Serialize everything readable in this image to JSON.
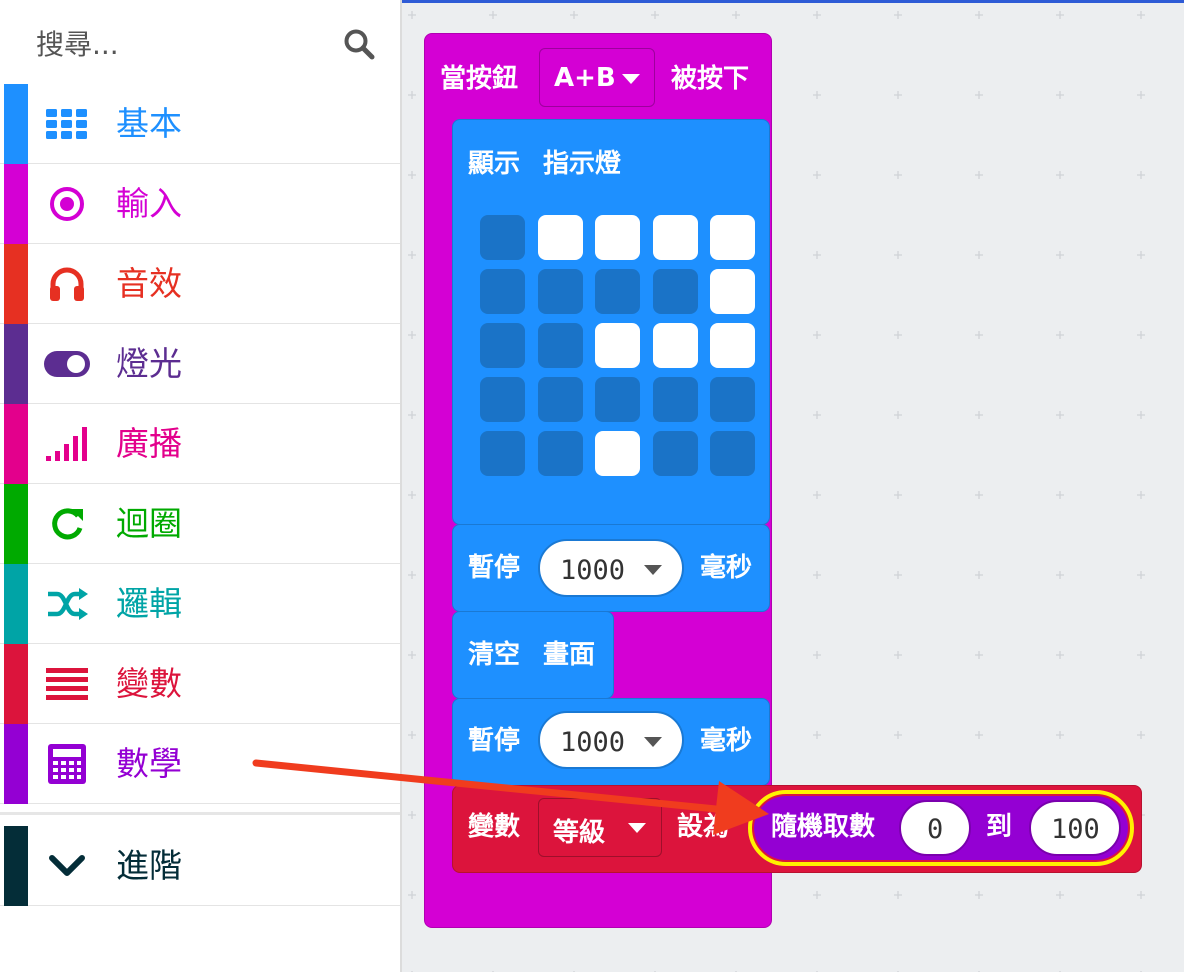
{
  "search": {
    "placeholder": "搜尋..."
  },
  "categories": [
    {
      "label": "基本",
      "color": "#1e90ff",
      "icon": "grid-icon"
    },
    {
      "label": "輸入",
      "color": "#d400d4",
      "icon": "target-icon"
    },
    {
      "label": "音效",
      "color": "#e63022",
      "icon": "headphones-icon"
    },
    {
      "label": "燈光",
      "color": "#5c2d91",
      "icon": "toggle-icon"
    },
    {
      "label": "廣播",
      "color": "#e3008c",
      "icon": "signal-bars-icon"
    },
    {
      "label": "迴圈",
      "color": "#00aa00",
      "icon": "refresh-icon"
    },
    {
      "label": "邏輯",
      "color": "#00a4a6",
      "icon": "shuffle-icon"
    },
    {
      "label": "變數",
      "color": "#dc143c",
      "icon": "lines-icon"
    },
    {
      "label": "數學",
      "color": "#9400d3",
      "icon": "calculator-icon"
    }
  ],
  "advanced": {
    "label": "進階",
    "color": "#042d38",
    "icon": "chevron-down-icon"
  },
  "blocks": {
    "event": {
      "prefix": "當按鈕",
      "button": "A+B",
      "suffix": "被按下"
    },
    "show_leds": {
      "label_1": "顯示",
      "label_2": "指示燈",
      "leds": [
        [
          0,
          1,
          1,
          1,
          1
        ],
        [
          0,
          0,
          0,
          0,
          1
        ],
        [
          0,
          0,
          1,
          1,
          1
        ],
        [
          0,
          0,
          0,
          0,
          0
        ],
        [
          0,
          0,
          1,
          0,
          0
        ]
      ]
    },
    "pause_1": {
      "label": "暫停",
      "value": "1000",
      "unit": "毫秒"
    },
    "clear": {
      "label_1": "清空",
      "label_2": "畫面"
    },
    "pause_2": {
      "label": "暫停",
      "value": "1000",
      "unit": "毫秒"
    },
    "set_var": {
      "label": "變數",
      "variable": "等級",
      "set_to": "設為"
    },
    "random": {
      "label": "隨機取數",
      "from": "0",
      "to_label": "到",
      "to": "100"
    }
  },
  "colors": {
    "event": "#d400d4",
    "event_dark": "#b100b1",
    "basic": "#1e90ff",
    "basic_dark": "#1a79d4",
    "variables": "#dc143c",
    "variables_dark": "#b8112f",
    "math": "#9400d3",
    "highlight": "#fff200",
    "arrow": "#f03c1e"
  }
}
